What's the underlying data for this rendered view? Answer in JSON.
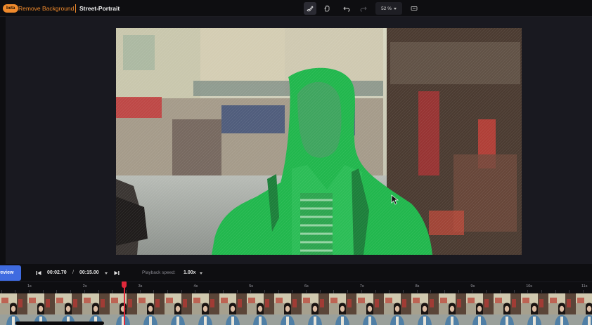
{
  "topbar": {
    "badge": "beta",
    "tool_name": "Remove Background",
    "project_name": "Street-Portrait",
    "zoom_value": "52 %"
  },
  "controls": {
    "preview_label": "Preview",
    "current_time": "00:02.70",
    "time_separator": "/",
    "total_time": "00:15.00",
    "playback_speed_label": "Playback speed:",
    "playback_speed_value": "1.00x"
  },
  "ruler": {
    "ticks": [
      "1s",
      "2s",
      "3s",
      "4s",
      "5s",
      "6s",
      "7s",
      "8s",
      "9s",
      "10s",
      "11s"
    ]
  },
  "colors": {
    "accent_orange": "#f08a2c",
    "preview_blue": "#3f6be0",
    "playhead_red": "#e0283a",
    "mask_green": "#1fb84a"
  }
}
